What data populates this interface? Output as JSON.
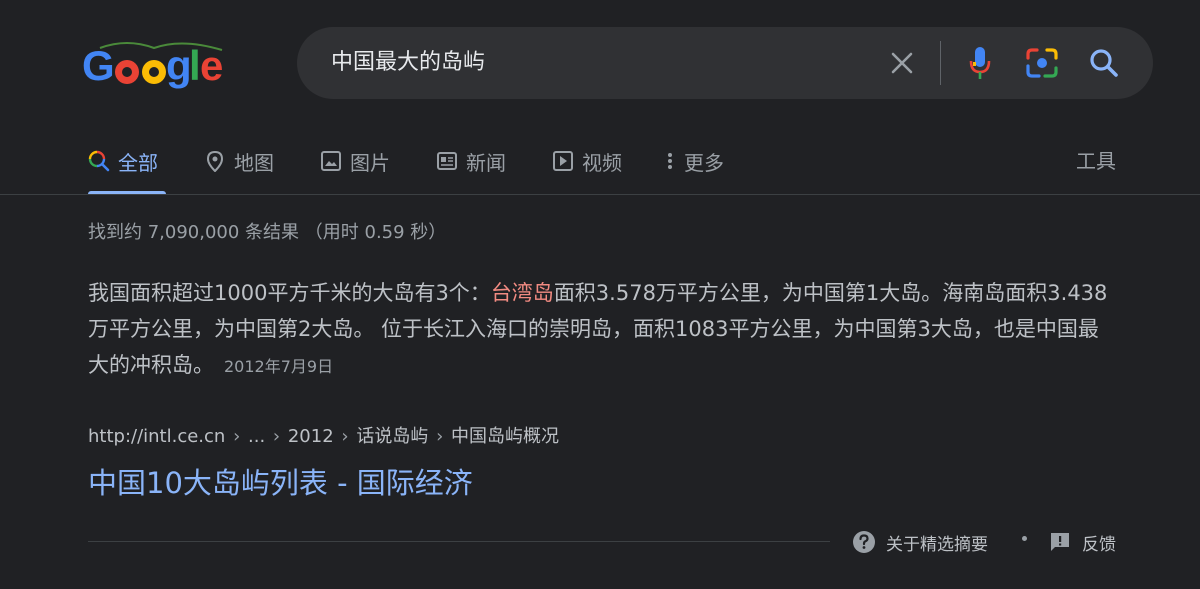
{
  "logo": {
    "letters": [
      "G",
      "o",
      "o",
      "g",
      "l",
      "e"
    ]
  },
  "search": {
    "query": "中国最大的岛屿"
  },
  "tabs": [
    {
      "label": "全部",
      "icon": "search-icon",
      "active": true
    },
    {
      "label": "地图",
      "icon": "map-pin-icon"
    },
    {
      "label": "图片",
      "icon": "image-icon"
    },
    {
      "label": "新闻",
      "icon": "news-icon"
    },
    {
      "label": "视频",
      "icon": "play-icon"
    },
    {
      "label": "更多",
      "icon": "more-vert-icon"
    }
  ],
  "tools_label": "工具",
  "result_stats": "找到约 7,090,000 条结果 （用时 0.59 秒）",
  "snippet": {
    "part1": "我国面积超过1000平方千米的大岛有3个：",
    "highlight": "台湾岛",
    "part2": "面积3.578万平方公里，为中国第1大岛。海南岛面积3.438万平方公里，为中国第2大岛。 位于长江入海口的崇明岛，面积1083平方公里，为中国第3大岛，也是中国最大的冲积岛。",
    "date": "2012年7月9日"
  },
  "result": {
    "breadcrumb": [
      "http://intl.ce.cn",
      "...",
      "2012",
      "话说岛屿",
      "中国岛屿概况"
    ],
    "title": "中国10大岛屿列表 - 国际经济"
  },
  "footer": {
    "about_label": "关于精选摘要",
    "feedback_label": "反馈"
  },
  "colors": {
    "background": "#202124",
    "accent": "#8ab4f8",
    "highlight": "#f28b82",
    "search_box": "#303134"
  }
}
